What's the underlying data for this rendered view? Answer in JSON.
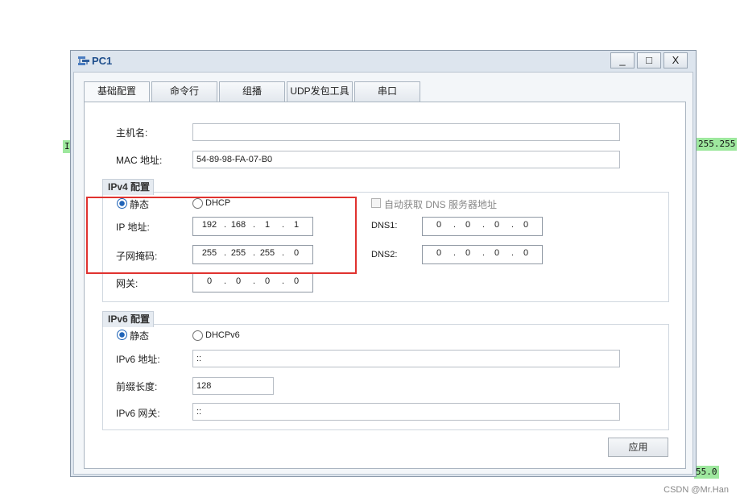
{
  "background_tags": {
    "left": "I",
    "right_top": "255.255",
    "right_bottom": "55.0"
  },
  "window": {
    "title": "PC1",
    "controls": {
      "minimize": "_",
      "maximize": "□",
      "close": "X"
    }
  },
  "tabs": [
    {
      "label": "基础配置",
      "active": true
    },
    {
      "label": "命令行"
    },
    {
      "label": "组播"
    },
    {
      "label": "UDP发包工具"
    },
    {
      "label": "串口"
    }
  ],
  "basic": {
    "hostname_label": "主机名:",
    "hostname_value": "",
    "mac_label": "MAC 地址:",
    "mac_value": "54-89-98-FA-07-B0"
  },
  "ipv4": {
    "title": "IPv4 配置",
    "static_label": "静态",
    "dhcp_label": "DHCP",
    "auto_dns_label": "自动获取 DNS 服务器地址",
    "ip_label": "IP 地址:",
    "ip": [
      "192",
      "168",
      "1",
      "1"
    ],
    "mask_label": "子网掩码:",
    "mask": [
      "255",
      "255",
      "255",
      "0"
    ],
    "gateway_label": "网关:",
    "gateway": [
      "0",
      "0",
      "0",
      "0"
    ],
    "dns1_label": "DNS1:",
    "dns1": [
      "0",
      "0",
      "0",
      "0"
    ],
    "dns2_label": "DNS2:",
    "dns2": [
      "0",
      "0",
      "0",
      "0"
    ]
  },
  "ipv6": {
    "title": "IPv6 配置",
    "static_label": "静态",
    "dhcp_label": "DHCPv6",
    "ip_label": "IPv6 地址:",
    "ip_value": "::",
    "prefix_label": "前缀长度:",
    "prefix_value": "128",
    "gateway_label": "IPv6 网关:",
    "gateway_value": "::"
  },
  "apply_label": "应用",
  "watermark": "CSDN @Mr.Han"
}
